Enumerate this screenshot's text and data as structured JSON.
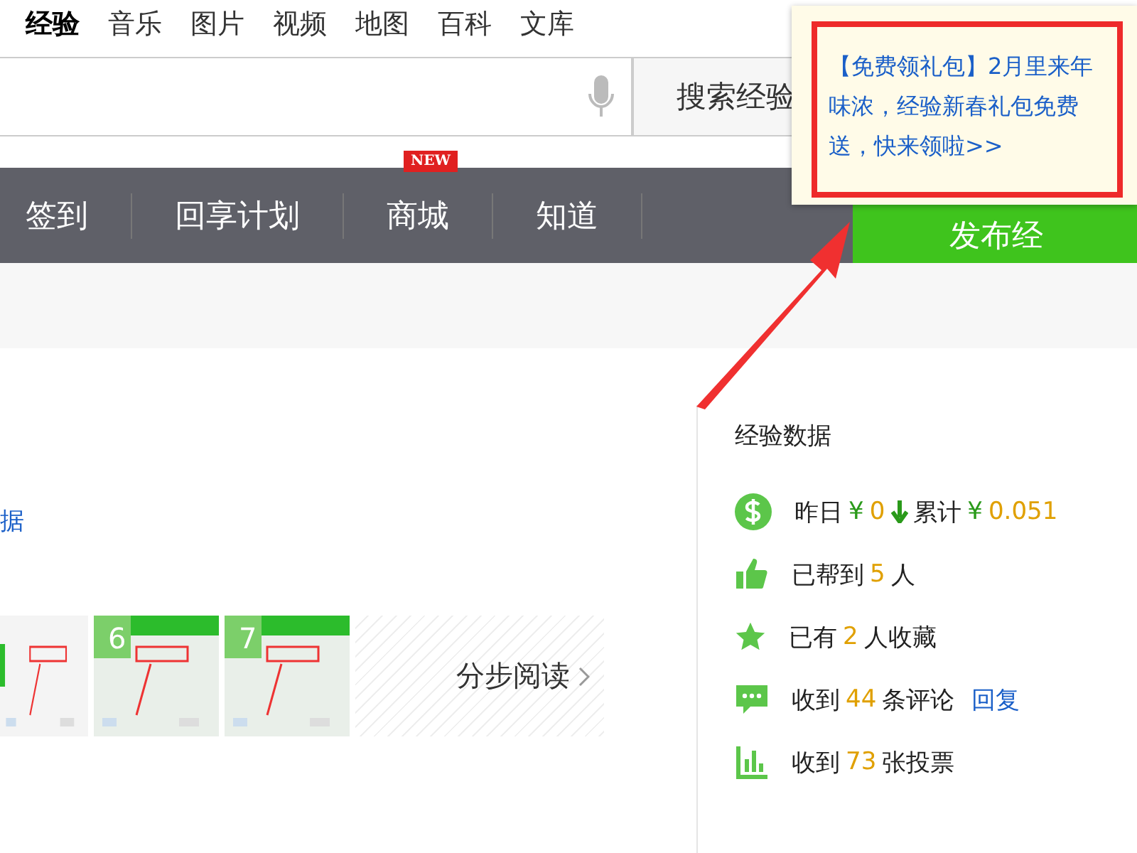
{
  "top_nav": [
    {
      "label": "经验",
      "selected": true
    },
    {
      "label": "音乐",
      "selected": false
    },
    {
      "label": "图片",
      "selected": false
    },
    {
      "label": "视频",
      "selected": false
    },
    {
      "label": "地图",
      "selected": false
    },
    {
      "label": "百科",
      "selected": false
    },
    {
      "label": "文库",
      "selected": false
    }
  ],
  "search": {
    "button": "搜索经验"
  },
  "menu": [
    {
      "label": "签到"
    },
    {
      "label": "回享计划"
    },
    {
      "label": "商城",
      "badge": "NEW"
    },
    {
      "label": "知道"
    }
  ],
  "publish_button": "发布经",
  "popup": {
    "text": "【免费领礼包】2月里来年味浓，经验新春礼包免费送，快来领啦>>"
  },
  "article": {
    "link_fragment": "据",
    "steps": [
      {
        "kind": "picture"
      },
      {
        "kind": "picture",
        "number": "6"
      },
      {
        "kind": "picture",
        "number": "7"
      }
    ],
    "step_read": "分步阅读"
  },
  "stats": {
    "title": "经验数据",
    "rows": [
      {
        "kind": "money",
        "parts": [
          {
            "kind": "text",
            "text": "昨日"
          },
          {
            "kind": "money",
            "text": "¥"
          },
          {
            "kind": "number",
            "text": "0"
          },
          {
            "kind": "down"
          },
          {
            "kind": "text",
            "text": "累计"
          },
          {
            "kind": "money",
            "text": "¥"
          },
          {
            "kind": "number",
            "text": "0.051"
          }
        ]
      },
      {
        "kind": "thumb",
        "parts": [
          {
            "kind": "text",
            "text": "已帮到"
          },
          {
            "kind": "number",
            "text": "5"
          },
          {
            "kind": "text",
            "text": "人"
          }
        ]
      },
      {
        "kind": "star",
        "parts": [
          {
            "kind": "text",
            "text": "已有"
          },
          {
            "kind": "number",
            "text": "2"
          },
          {
            "kind": "text",
            "text": "人收藏"
          }
        ]
      },
      {
        "kind": "comment",
        "parts": [
          {
            "kind": "text",
            "text": "收到"
          },
          {
            "kind": "number",
            "text": "44"
          },
          {
            "kind": "text",
            "text": "条评论"
          },
          {
            "kind": "link",
            "text": "回复"
          }
        ]
      },
      {
        "kind": "chart",
        "parts": [
          {
            "kind": "text",
            "text": "收到"
          },
          {
            "kind": "number",
            "text": "73"
          },
          {
            "kind": "text",
            "text": "张投票"
          }
        ]
      }
    ]
  }
}
